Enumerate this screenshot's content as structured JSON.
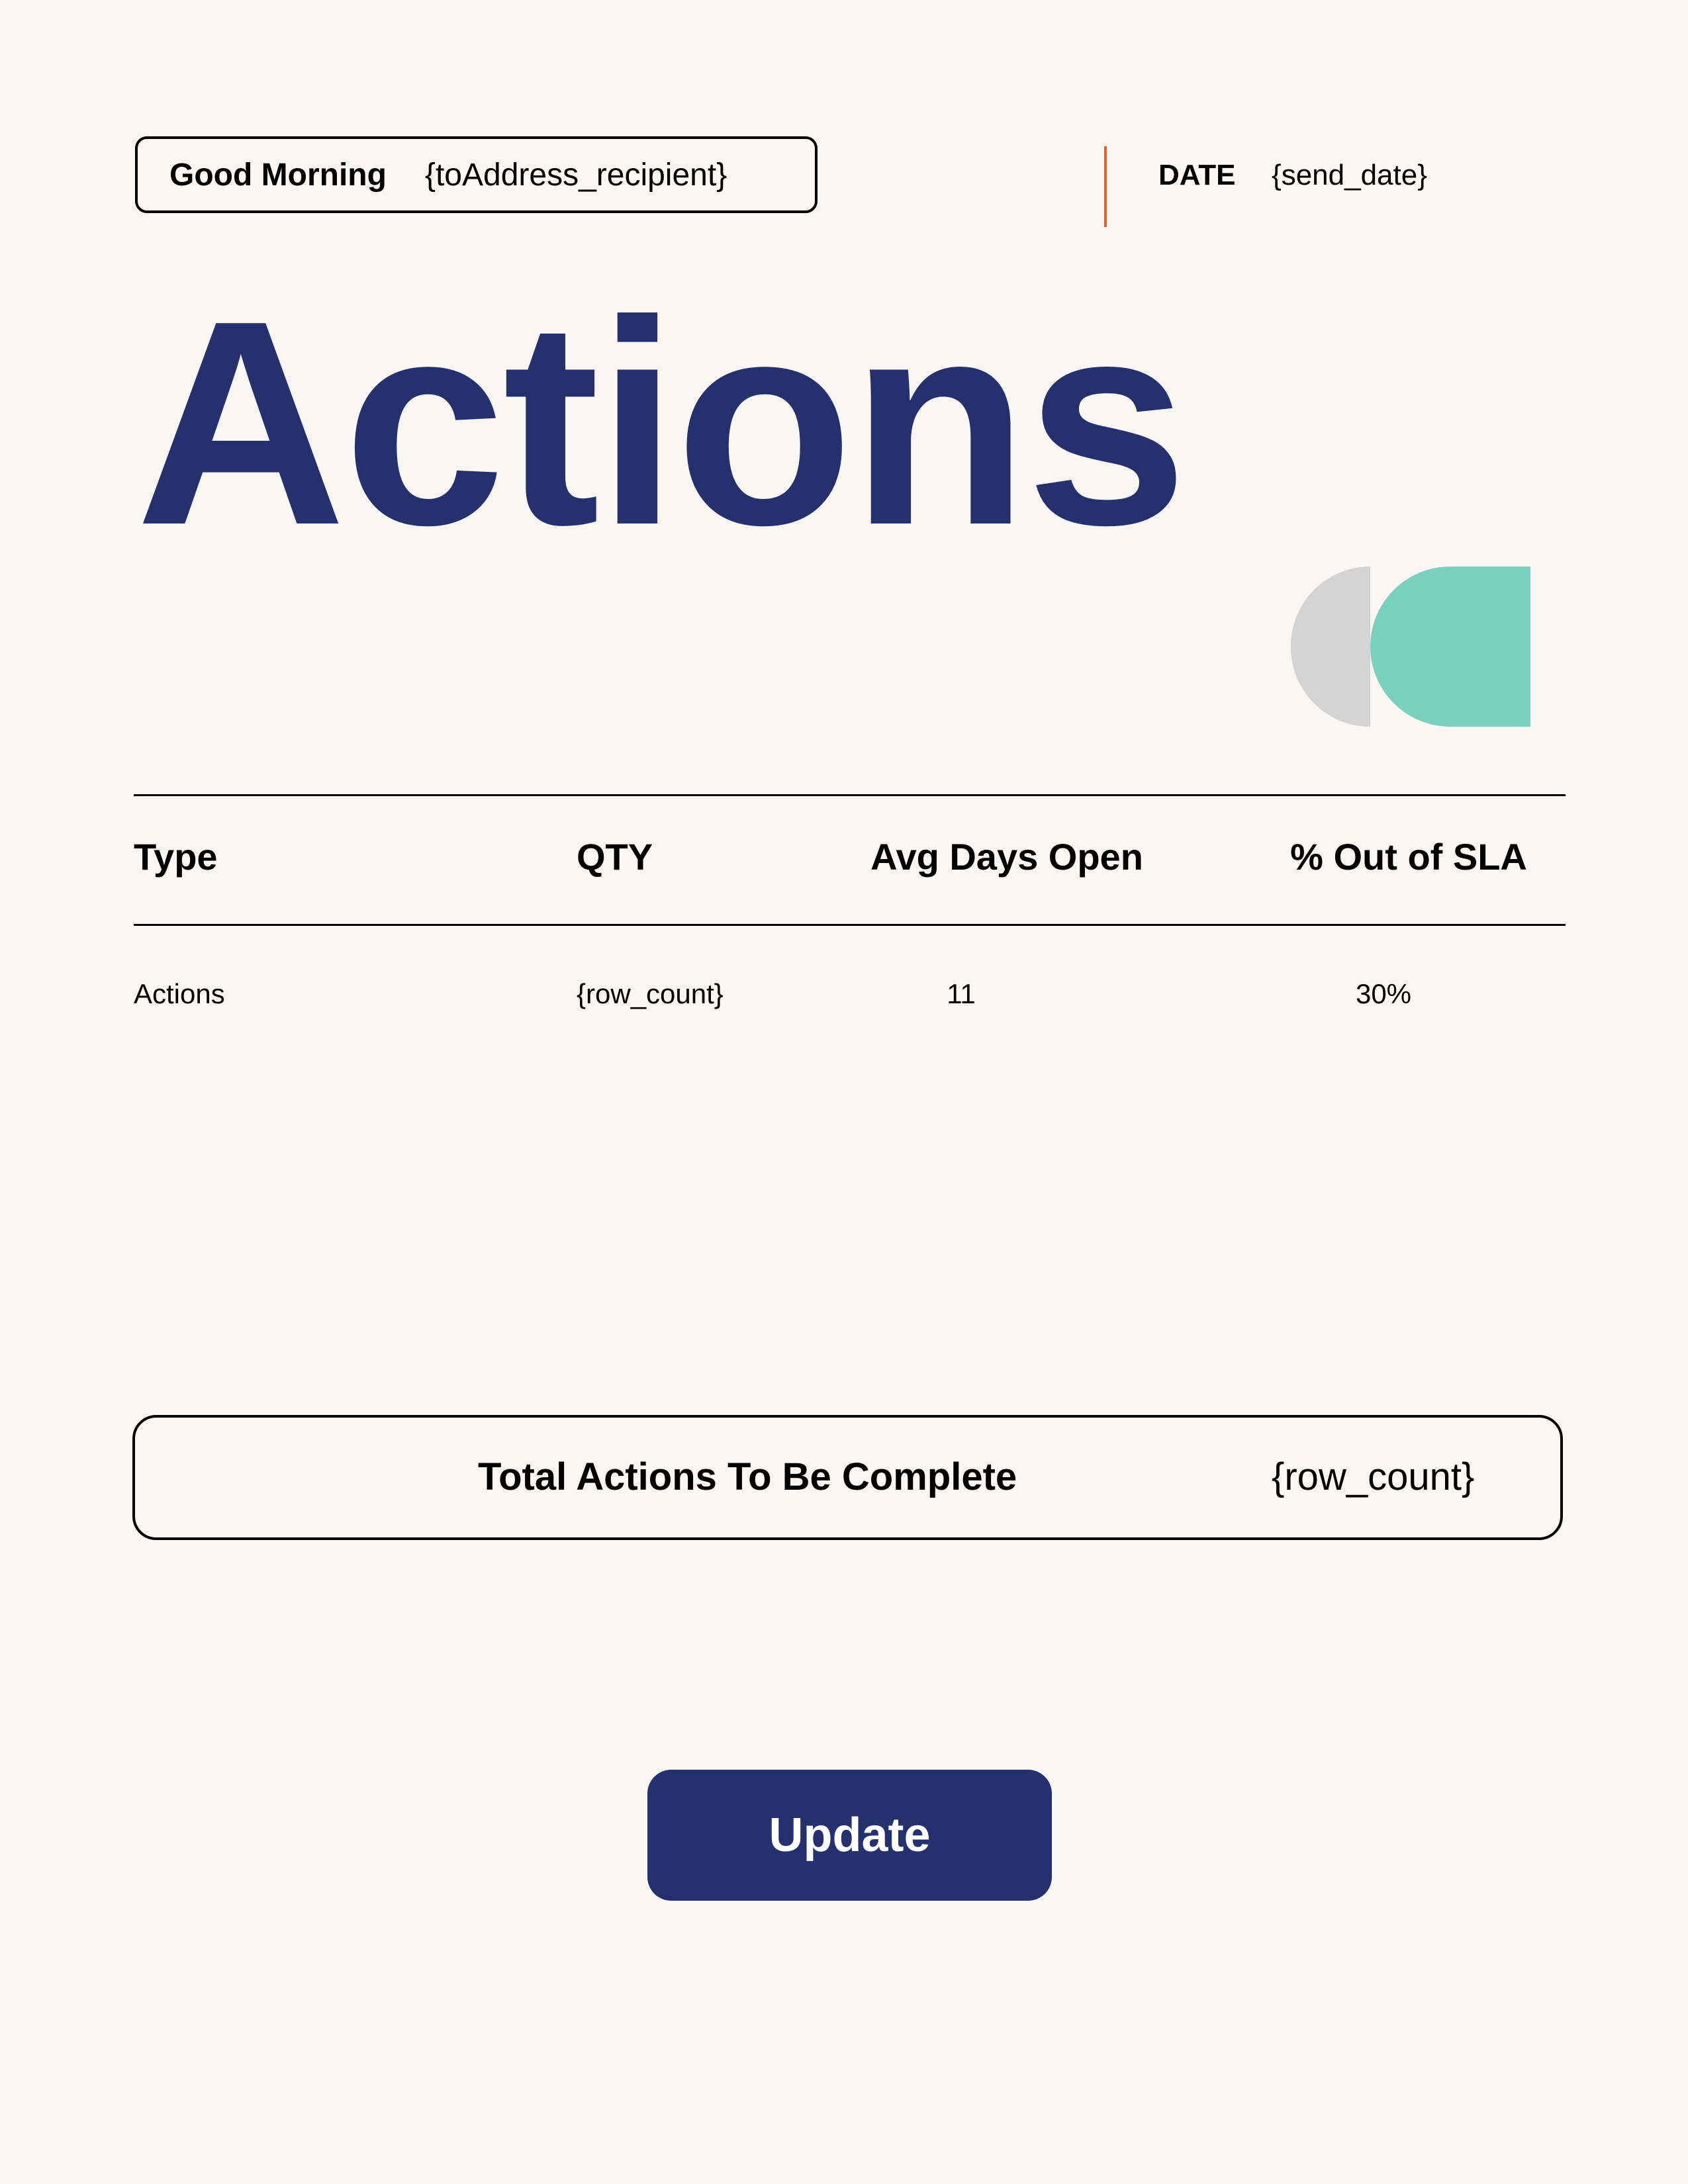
{
  "greeting": {
    "label": "Good Morning",
    "recipient": "{toAddress_recipient}"
  },
  "date": {
    "label": "DATE",
    "value": "{send_date}"
  },
  "title": "Actions",
  "colors": {
    "background": "#f9f6f3",
    "navy": "#25316e",
    "teal": "#79d0bc",
    "gray": "#d4d4d4",
    "accent_line": "#e0622a"
  },
  "table": {
    "headers": [
      "Type",
      "QTY",
      "Avg Days Open",
      "% Out of SLA"
    ],
    "rows": [
      [
        "Actions",
        "{row_count}",
        "11",
        "30%"
      ]
    ]
  },
  "total": {
    "label": "Total Actions To Be Complete",
    "value": "{row_count}"
  },
  "update_button": "Update"
}
